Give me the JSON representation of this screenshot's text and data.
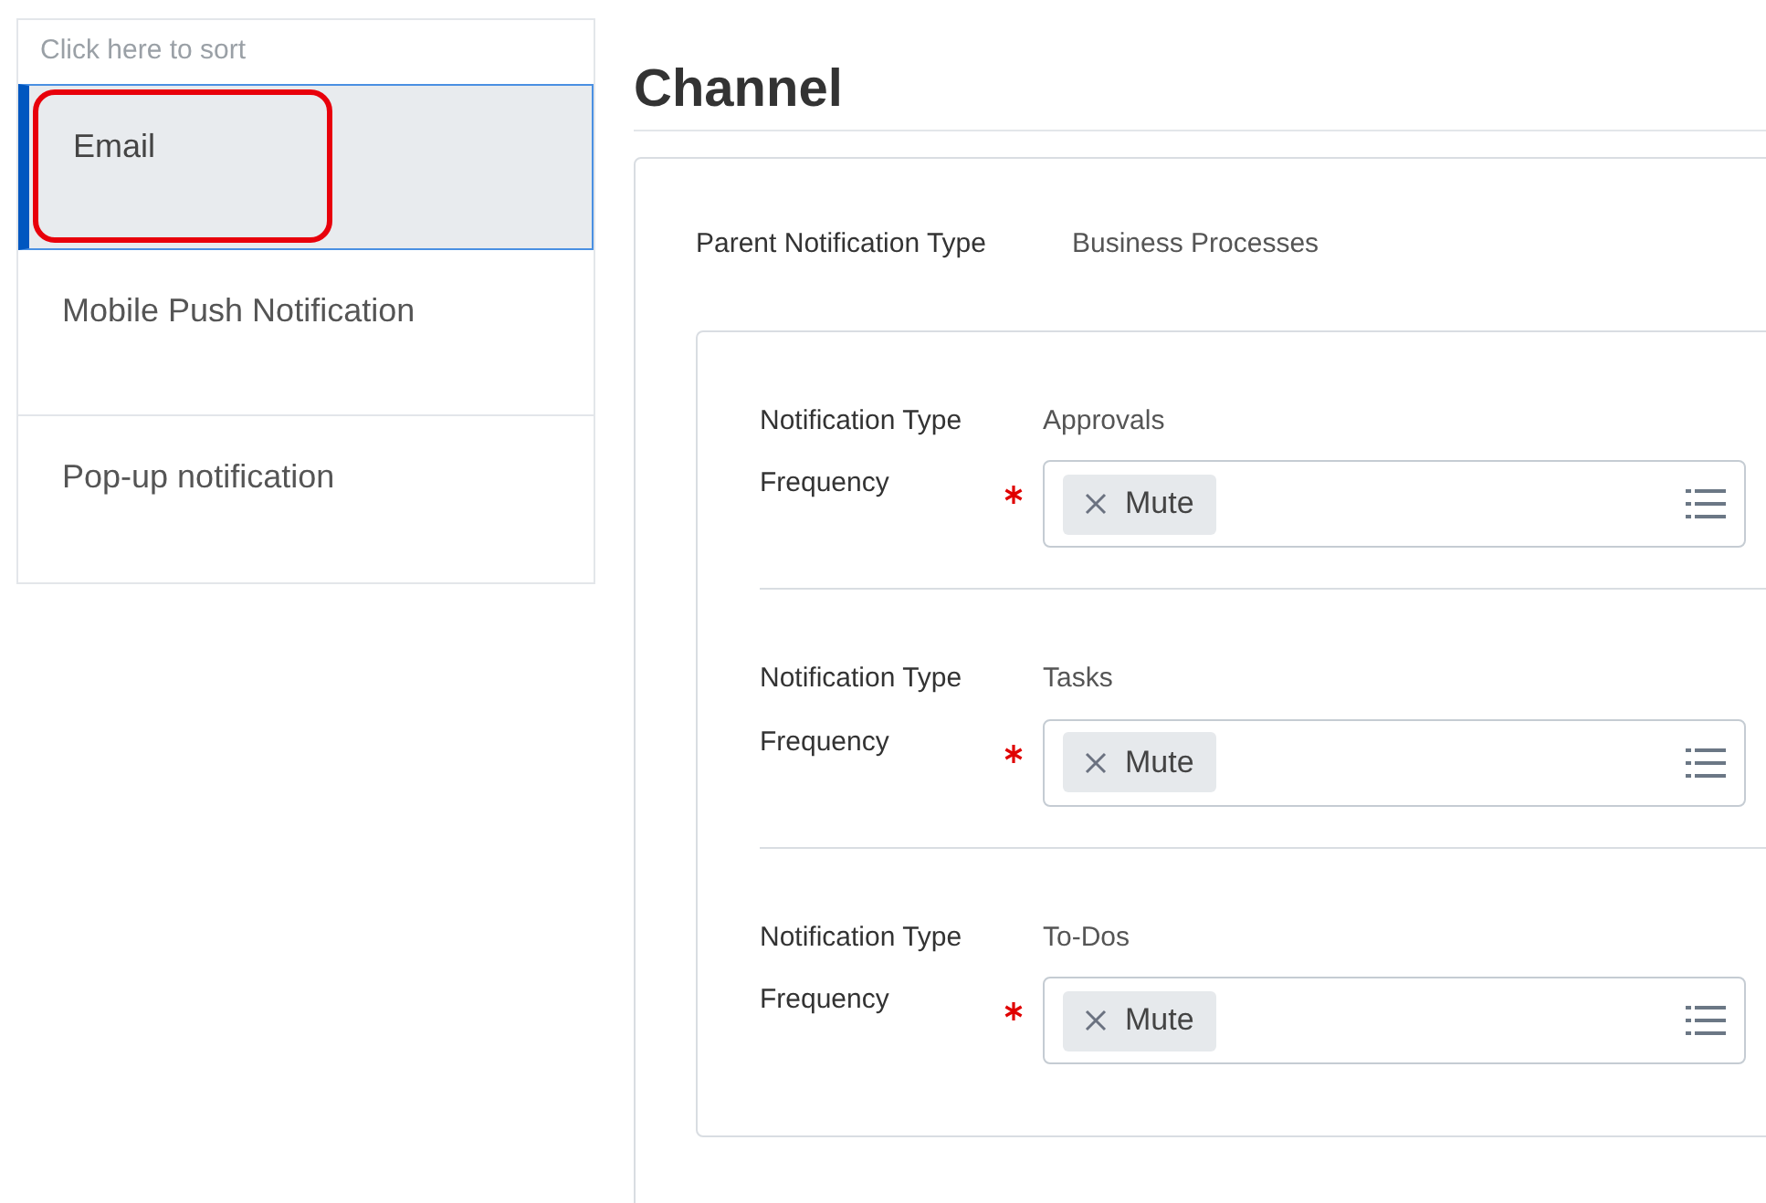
{
  "sidebar": {
    "sort_hint": "Click here to sort",
    "items": [
      {
        "label": "Email",
        "selected": true,
        "highlighted": true
      },
      {
        "label": "Mobile Push Notification",
        "selected": false,
        "highlighted": false
      },
      {
        "label": "Pop-up notification",
        "selected": false,
        "highlighted": false
      }
    ]
  },
  "main": {
    "title": "Channel",
    "parent": {
      "label": "Parent Notification Type",
      "value": "Business Processes"
    },
    "groups": [
      {
        "type_label": "Notification Type",
        "type_value": "Approvals",
        "frequency_label": "Frequency",
        "required": true,
        "chips": [
          "Mute"
        ]
      },
      {
        "type_label": "Notification Type",
        "type_value": "Tasks",
        "frequency_label": "Frequency",
        "required": true,
        "chips": [
          "Mute"
        ]
      },
      {
        "type_label": "Notification Type",
        "type_value": "To-Dos",
        "frequency_label": "Frequency",
        "required": true,
        "chips": [
          "Mute"
        ]
      }
    ]
  }
}
